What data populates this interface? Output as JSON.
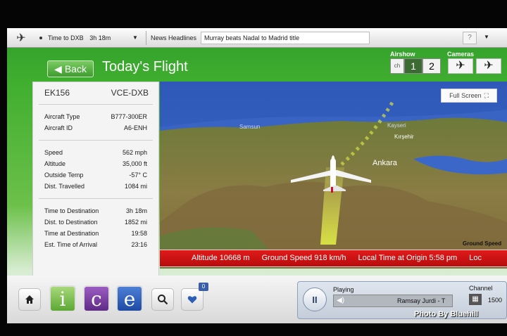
{
  "topbar": {
    "time_to_label": "Time to DXB",
    "time_to_value": "3h 18m",
    "news_label": "News Headlines",
    "news_text": "Murray beats Nadal to Madrid title",
    "help": "?"
  },
  "header": {
    "back_label": "Back",
    "title": "Today's Flight",
    "airshow_label": "Airshow",
    "cameras_label": "Cameras",
    "ch_label": "ch",
    "ch1": "1",
    "ch2": "2"
  },
  "info": {
    "flight": "EK156",
    "route": "VCE-DXB",
    "rows_a": [
      {
        "label": "Aircraft Type",
        "value": "B777-300ER"
      },
      {
        "label": "Aircraft ID",
        "value": "A6-ENH"
      }
    ],
    "rows_b": [
      {
        "label": "Speed",
        "value": "562 mph"
      },
      {
        "label": "Altitude",
        "value": "35,000 ft"
      },
      {
        "label": "Outside Temp",
        "value": "-57° C"
      },
      {
        "label": "Dist. Travelled",
        "value": "1084 mi"
      }
    ],
    "rows_c": [
      {
        "label": "Time to Destination",
        "value": "3h 18m"
      },
      {
        "label": "Dist. to Destination",
        "value": "1852 mi"
      },
      {
        "label": "Time at Destination",
        "value": "19:58"
      },
      {
        "label": "Est. Time of Arrival",
        "value": "23:16"
      }
    ]
  },
  "map": {
    "fullscreen_label": "Full Screen",
    "cities": {
      "samsun": "Samsun",
      "kayseri": "Kayseri",
      "kirsehir": "Kırşehir",
      "ankara": "Ankara"
    },
    "ground_speed_label": "Ground Speed"
  },
  "ticker": {
    "altitude": "Altitude 10668 m",
    "ground_speed": "Ground Speed 918 km/h",
    "local_time": "Local Time at Origin 5:58 pm",
    "overflow": "Loc"
  },
  "bottom": {
    "badge": "0",
    "playing_label": "Playing",
    "track": "Ramsay Jurdi - T",
    "channel_label": "Channel",
    "channel_number": "1500"
  },
  "credit": "Photo By Bluehill",
  "colors": {
    "accent_green": "#3fae2f",
    "ticker_red": "#d31414",
    "ice_i": "#7cbf4a",
    "ice_c": "#7a3aa0",
    "ice_e": "#2d5bb5"
  }
}
